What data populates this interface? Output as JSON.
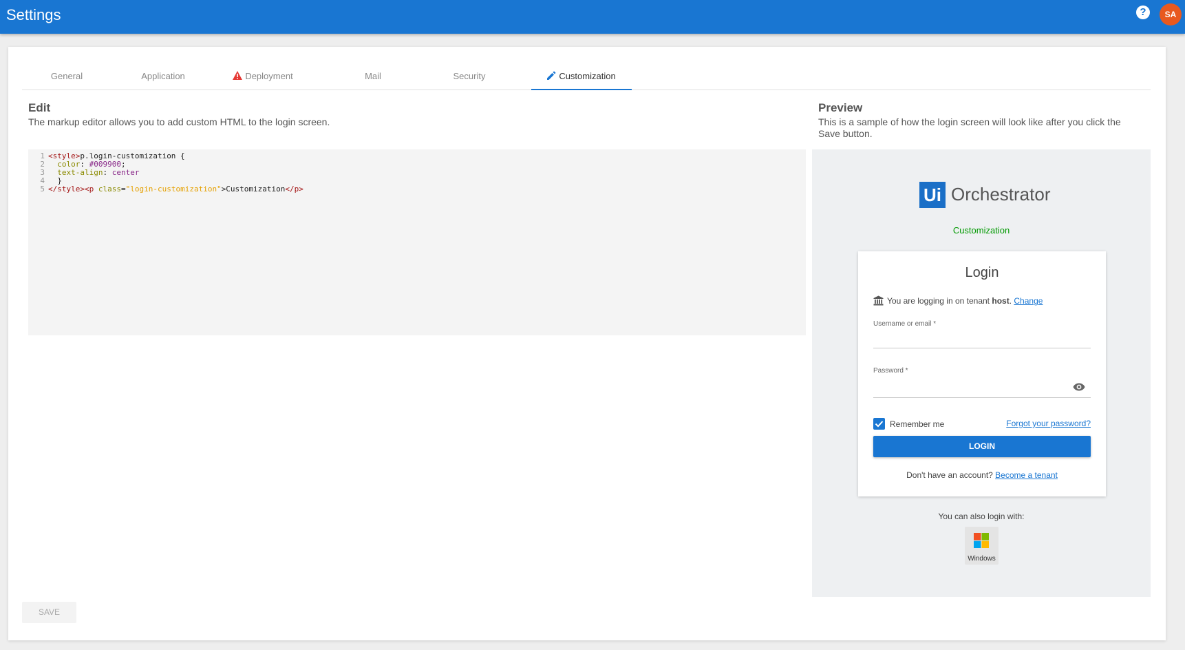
{
  "header": {
    "title": "Settings",
    "help_icon": "?",
    "avatar_initials": "SA"
  },
  "tabs": [
    {
      "label": "General"
    },
    {
      "label": "Application"
    },
    {
      "label": "Deployment",
      "icon": "warning-icon"
    },
    {
      "label": "Mail"
    },
    {
      "label": "Security"
    },
    {
      "label": "Customization",
      "icon": "pencil-icon",
      "active": true
    }
  ],
  "edit": {
    "title": "Edit",
    "description": "The markup editor allows you to add custom HTML to the login screen.",
    "lines": [
      {
        "num": "1",
        "parts": [
          [
            "tag",
            "<style>"
          ],
          [
            "txt",
            "p.login-customization {"
          ]
        ]
      },
      {
        "num": "2",
        "parts": [
          [
            "txt",
            "  "
          ],
          [
            "prop",
            "color"
          ],
          [
            "txt",
            ": "
          ],
          [
            "val",
            "#009900"
          ],
          [
            "txt",
            ";"
          ]
        ]
      },
      {
        "num": "3",
        "parts": [
          [
            "txt",
            "  "
          ],
          [
            "prop",
            "text-align"
          ],
          [
            "txt",
            ": "
          ],
          [
            "val",
            "center"
          ]
        ]
      },
      {
        "num": "4",
        "parts": [
          [
            "txt",
            "  }"
          ]
        ]
      },
      {
        "num": "5",
        "parts": [
          [
            "tag",
            "</style><p "
          ],
          [
            "prop",
            "class"
          ],
          [
            "txt",
            "="
          ],
          [
            "str",
            "\"login-customization\""
          ],
          [
            "txt",
            ">Customization"
          ],
          [
            "tag",
            "</p>"
          ]
        ]
      }
    ]
  },
  "preview": {
    "title": "Preview",
    "description": "This is a sample of how the login screen will look like after you click the Save button.",
    "logo_mark": "Ui",
    "logo_text": "Orchestrator",
    "customization_text": "Customization",
    "login": {
      "title": "Login",
      "tenant_prefix": "You are logging in on tenant ",
      "tenant_name": "host",
      "tenant_suffix": ". ",
      "change_link": "Change",
      "username_label": "Username or email *",
      "password_label": "Password *",
      "remember_label": "Remember me",
      "remember_checked": true,
      "forgot_link": "Forgot your password?",
      "login_button": "LOGIN",
      "signup_prefix": "Don't have an account? ",
      "signup_link": "Become a tenant"
    },
    "also_login": "You can also login with:",
    "windows_label": "Windows"
  },
  "footer": {
    "save_button": "SAVE"
  },
  "colors": {
    "primary": "#1976d2",
    "avatar": "#e8591f",
    "customization": "#009900",
    "warning": "#e53935"
  }
}
